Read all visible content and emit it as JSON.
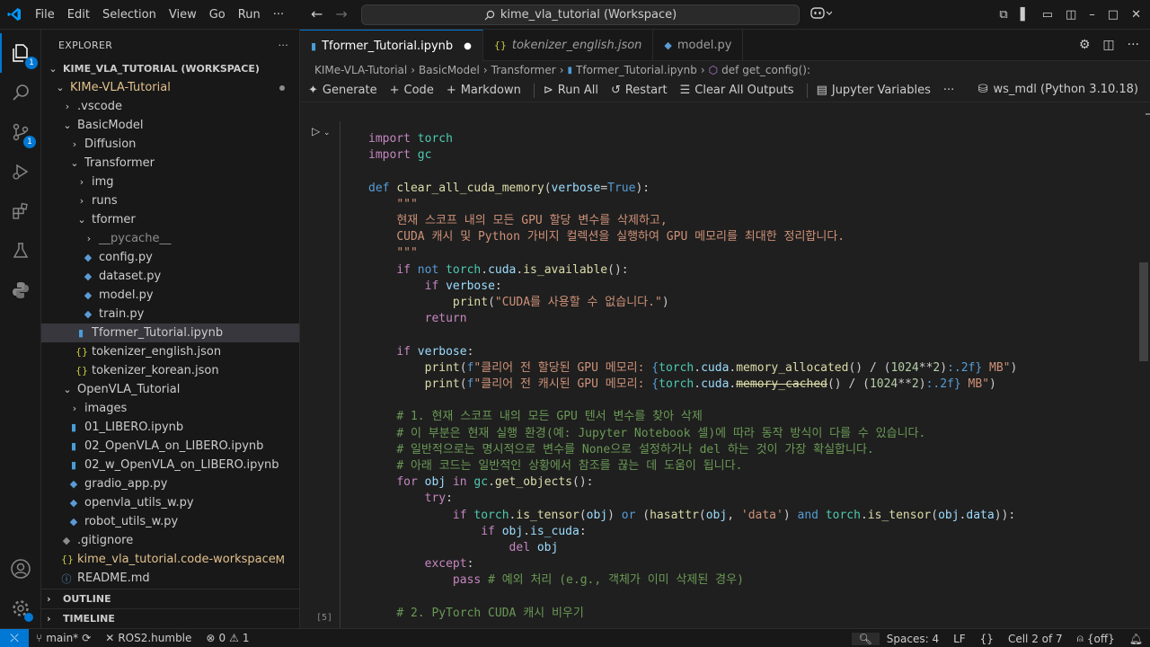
{
  "menu": [
    "File",
    "Edit",
    "Selection",
    "View",
    "Go",
    "Run",
    "···"
  ],
  "command_center": "kime_vla_tutorial (Workspace)",
  "activity": {
    "explorer_badge": "1",
    "scm_badge": "1"
  },
  "sidebar": {
    "title": "EXPLORER",
    "workspace": "KIME_VLA_TUTORIAL (WORKSPACE)",
    "items": [
      {
        "label": "KIMe-VLA-Tutorial"
      },
      {
        "label": ".vscode"
      },
      {
        "label": "BasicModel"
      },
      {
        "label": "Diffusion"
      },
      {
        "label": "Transformer"
      },
      {
        "label": "img"
      },
      {
        "label": "runs"
      },
      {
        "label": "tformer"
      },
      {
        "label": "__pycache__"
      },
      {
        "label": "config.py"
      },
      {
        "label": "dataset.py"
      },
      {
        "label": "model.py"
      },
      {
        "label": "train.py"
      },
      {
        "label": "Tformer_Tutorial.ipynb"
      },
      {
        "label": "tokenizer_english.json"
      },
      {
        "label": "tokenizer_korean.json"
      },
      {
        "label": "OpenVLA_Tutorial"
      },
      {
        "label": "images"
      },
      {
        "label": "01_LIBERO.ipynb"
      },
      {
        "label": "02_OpenVLA_on_LIBERO.ipynb"
      },
      {
        "label": "02_w_OpenVLA_on_LIBERO.ipynb"
      },
      {
        "label": "gradio_app.py"
      },
      {
        "label": "openvla_utils_w.py"
      },
      {
        "label": "robot_utils_w.py"
      },
      {
        "label": ".gitignore"
      },
      {
        "label": "kime_vla_tutorial.code-workspace",
        "flag": "M"
      },
      {
        "label": "README.md"
      }
    ],
    "outline": "OUTLINE",
    "timeline": "TIMELINE"
  },
  "tabs": [
    {
      "label": "Tformer_Tutorial.ipynb"
    },
    {
      "label": "tokenizer_english.json"
    },
    {
      "label": "model.py"
    }
  ],
  "breadcrumb": [
    "KIMe-VLA-Tutorial",
    "BasicModel",
    "Transformer",
    "Tformer_Tutorial.ipynb",
    "def get_config():"
  ],
  "toolbar": {
    "generate": "Generate",
    "code": "Code",
    "markdown": "Markdown",
    "run_all": "Run All",
    "restart": "Restart",
    "clear_outputs": "Clear All Outputs",
    "jupyter_vars": "Jupyter Variables",
    "more": "···",
    "kernel": "ws_mdl (Python 3.10.18)"
  },
  "cell": {
    "exec_count": "[5]"
  },
  "status": {
    "branch": "main*",
    "ros": "ROS2.humble",
    "errors": "0",
    "warnings": "1",
    "spaces": "Spaces: 4",
    "eol": "LF",
    "cell": "Cell 2 of 7",
    "off": "{off}"
  },
  "colors": {
    "accent": "#0078d4",
    "background": "#1f1f1f",
    "sidebar": "#181818"
  }
}
